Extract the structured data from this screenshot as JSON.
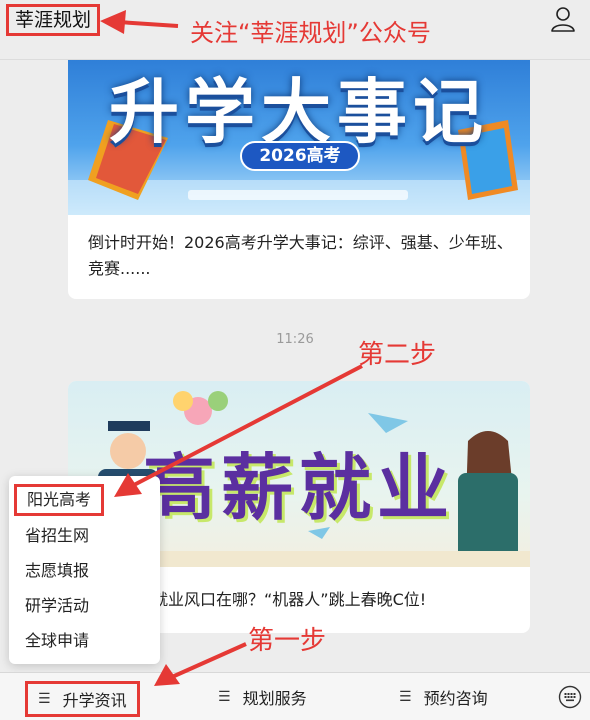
{
  "header": {
    "account_name": "莘涯规划",
    "annotation": "关注“莘涯规划”公众号"
  },
  "cards": [
    {
      "banner_title": "升学大事记",
      "banner_badge": "2026高考",
      "text": "倒计时开始！2026高考升学大事记：综评、强基、少年班、竞赛......"
    },
    {
      "banner_title": "高薪就业",
      "text": "热门品牌就业风口在哪？“机器人”跳上春晚C位!"
    }
  ],
  "timestamp": "11:26",
  "annotations": {
    "step1": "第一步",
    "step2": "第二步"
  },
  "popup_menu": {
    "items": [
      "阳光高考",
      "省招生网",
      "志愿填报",
      "研学活动",
      "全球申请"
    ]
  },
  "bottom_tabs": [
    "升学资讯",
    "规划服务",
    "预约咨询"
  ],
  "icons": {
    "profile": "person-icon",
    "keyboard": "keyboard-icon",
    "menu": "hamburger-icon"
  },
  "colors": {
    "annotation_red": "#e53935"
  }
}
